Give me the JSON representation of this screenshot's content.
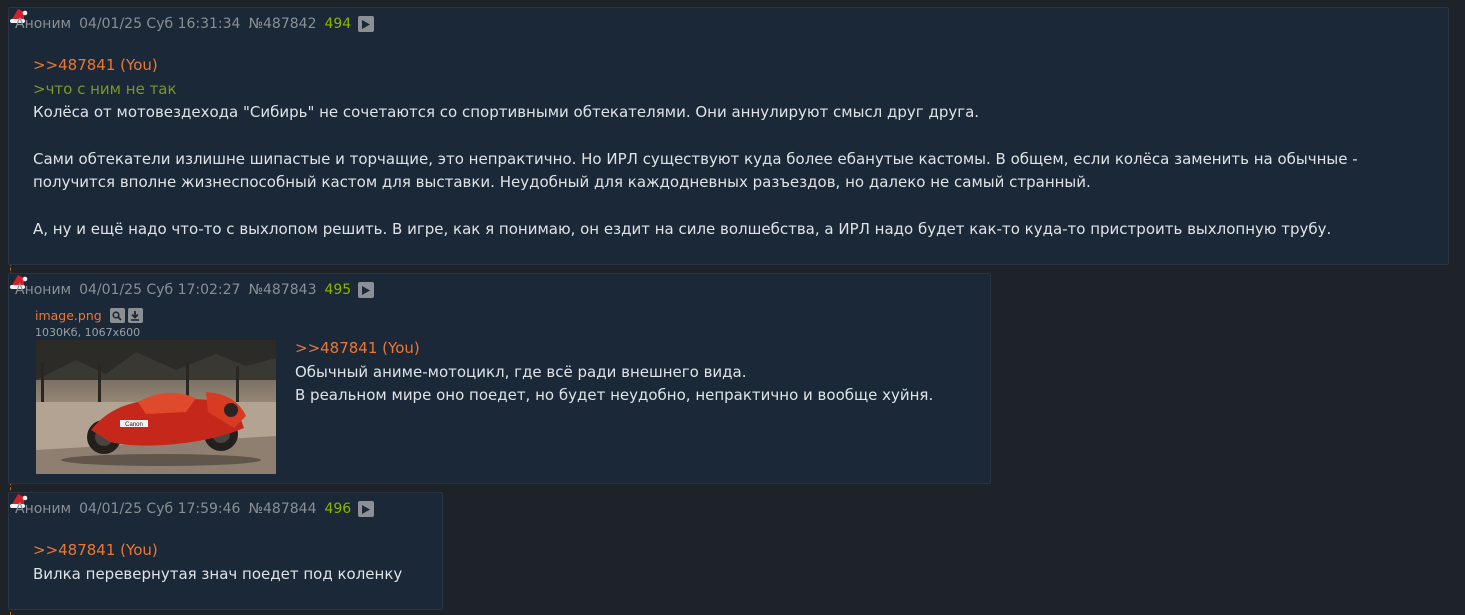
{
  "posts": [
    {
      "author": "Аноним",
      "date": "04/01/25 Суб 16:31:34",
      "post_id": "№487842",
      "post_number": "494",
      "reply_link": ">>487841 (You)",
      "greentext": ">что с ним не так",
      "paragraphs": [
        "Колёса от мотовездехода \"Сибирь\" не сочетаются со спортивными обтекателями. Они аннулируют смысл друг друга.",
        "Сами обтекатели излишне шипастые и торчащие, это непрактично. Но ИРЛ существуют куда более ебанутые кастомы. В общем, если колёса заменить на обычные - получится вполне жизнеспособный кастом для выставки. Неудобный для каждодневных разъездов, но далеко не самый странный.",
        "А, ну и ещё надо что-то с выхлопом решить. В игре, как я понимаю, он ездит на силе волшебства, а ИРЛ надо будет как-то куда-то пристроить выхлопную трубу."
      ]
    },
    {
      "author": "Аноним",
      "date": "04/01/25 Суб 17:02:27",
      "post_id": "№487843",
      "post_number": "495",
      "file_name": "image.png",
      "file_meta": "1030Кб, 1067x600",
      "reply_link": ">>487841 (You)",
      "lines": [
        "Обычный аниме-мотоцикл, где всё ради внешнего вида.",
        "В реальном мире оно поедет, но будет неудобно, непрактично и вообще хуйня."
      ],
      "image_text": "Canon"
    },
    {
      "author": "Аноним",
      "date": "04/01/25 Суб 17:59:46",
      "post_id": "№487844",
      "post_number": "496",
      "reply_link": ">>487841 (You)",
      "lines": [
        "Вилка перевернутая знач поедет под коленку"
      ]
    }
  ],
  "colors": {
    "background": "#1d2329",
    "post_background": "#1b2837",
    "reply_link": "#ee7633",
    "greentext": "#789922",
    "post_number": "#8db400"
  },
  "icons": [
    "santa-hat-icon",
    "play-icon",
    "search-icon",
    "download-icon"
  ]
}
